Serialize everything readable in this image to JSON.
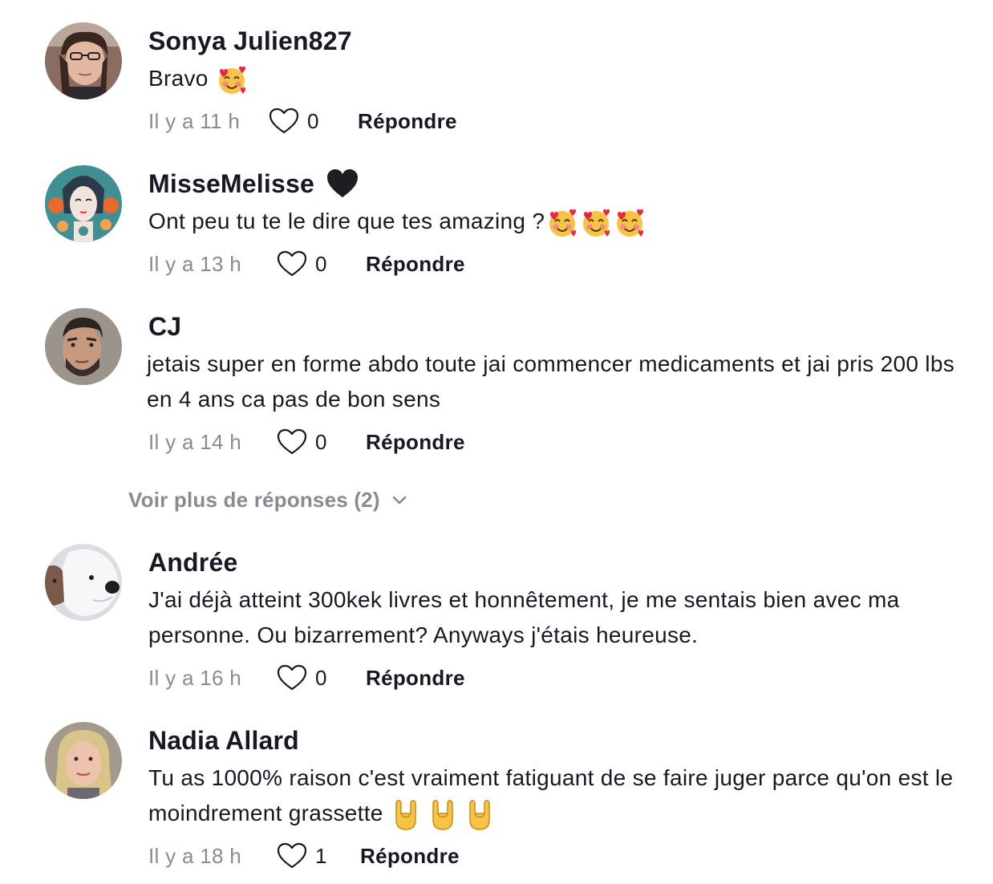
{
  "comments": [
    {
      "username": "Sonya Julien827",
      "text": "Bravo",
      "emoji": [
        "smiling-face-with-hearts"
      ],
      "time": "Il y a 11 h",
      "likes": "0",
      "reply": "Répondre"
    },
    {
      "username": "MisseMelisse",
      "username_emoji": "black-heart",
      "text": "Ont peu tu te le dire que tes amazing ?",
      "emoji": [
        "smiling-face-with-hearts",
        "smiling-face-with-hearts",
        "smiling-face-with-hearts"
      ],
      "time": "Il y a 13 h",
      "likes": "0",
      "reply": "Répondre"
    },
    {
      "username": "CJ",
      "text": "jetais super en forme abdo toute jai commencer medicaments et jai pris 200 lbs en 4 ans ca pas de bon sens",
      "time": "Il y a 14 h",
      "likes": "0",
      "reply": "Répondre"
    },
    {
      "username": "Andrée",
      "text": "J'ai déjà atteint 300kek livres et honnêtement, je me sentais bien avec ma personne. Ou bizarrement? Anyways j'étais heureuse.",
      "time": "Il y a 16 h",
      "likes": "0",
      "reply": "Répondre"
    },
    {
      "username": "Nadia Allard",
      "text": "Tu as 1000% raison c'est vraiment fatiguant de se faire juger parce qu'on est le moindrement grassette",
      "emoji": [
        "sign-of-the-horns",
        "sign-of-the-horns",
        "sign-of-the-horns"
      ],
      "time": "Il y a 18 h",
      "likes": "1",
      "reply": "Répondre"
    }
  ],
  "more_replies": "Voir plus de réponses (2)",
  "colors": {
    "text": "#161823",
    "muted": "#8a8b91",
    "background": "#ffffff"
  }
}
